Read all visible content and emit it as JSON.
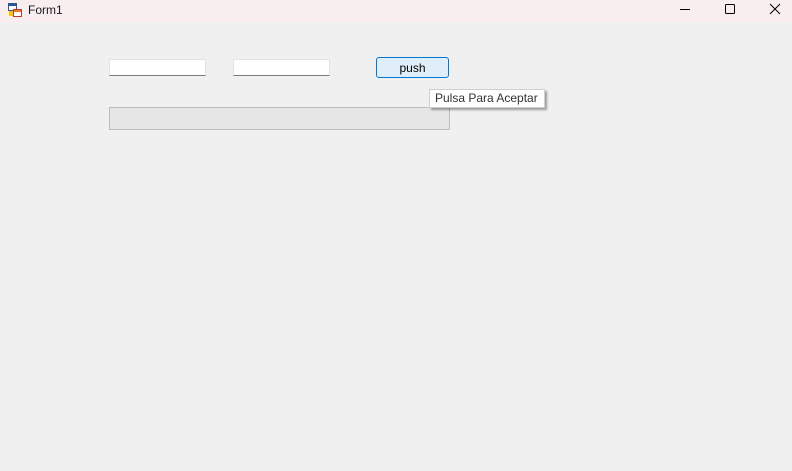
{
  "window": {
    "title": "Form1",
    "icon": "winforms-app-icon",
    "controls": {
      "minimize_icon": "minimize-icon",
      "maximize_icon": "maximize-icon",
      "close_icon": "close-icon"
    }
  },
  "form": {
    "textbox1": {
      "value": "",
      "placeholder": ""
    },
    "textbox2": {
      "value": "",
      "placeholder": ""
    },
    "push_button": {
      "label": "push"
    },
    "tooltip": {
      "text": "Pulsa Para Aceptar"
    },
    "progress_bar": {
      "value": 0
    }
  },
  "colors": {
    "window_bg": "#f0f0f0",
    "titlebar_bg": "#f8eef0",
    "button_focus_border": "#0078d4",
    "button_bg": "#e0eef9",
    "progress_fill": "#06b025"
  }
}
